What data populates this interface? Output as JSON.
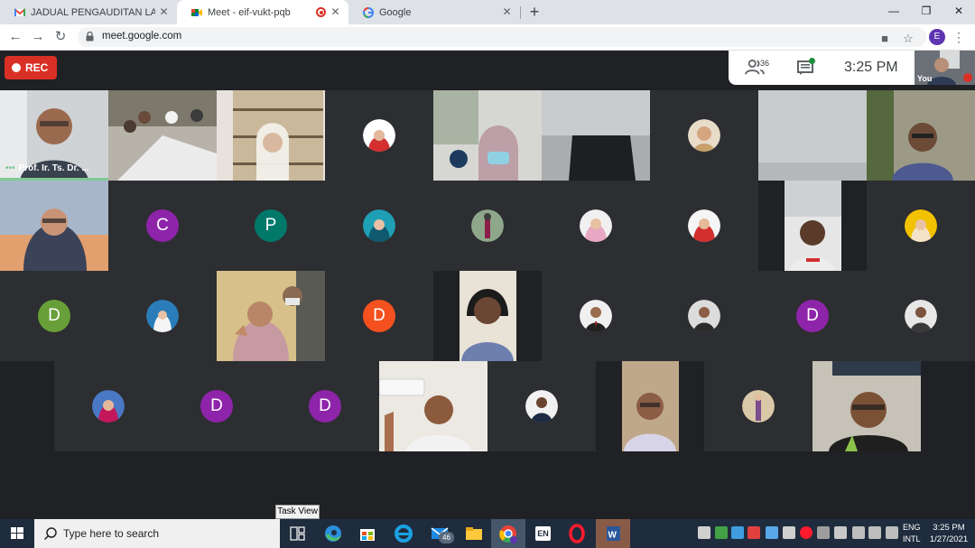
{
  "browser": {
    "tabs": [
      {
        "title": "JADUAL PENGAUDITAN LAWATA",
        "favicon": "gmail-icon",
        "active": false
      },
      {
        "title": "Meet - eif-vukt-pqb",
        "favicon": "meet-icon",
        "active": true,
        "recording": true
      },
      {
        "title": "Google",
        "favicon": "google-icon",
        "active": false
      }
    ],
    "new_tab_label": "+",
    "url": "meet.google.com",
    "profile_initial": "E"
  },
  "meet": {
    "rec_label": "REC",
    "participants_count": "36",
    "clock": "3:25 PM",
    "self_label": "You",
    "speaker_name": "Prof. Ir. Ts. Dr. ...",
    "letter_avatars": [
      {
        "letter": "C",
        "color": "#8e24aa"
      },
      {
        "letter": "P",
        "color": "#00796b"
      },
      {
        "letter": "D",
        "color": "#689f38"
      },
      {
        "letter": "D",
        "color": "#f4511e"
      },
      {
        "letter": "D",
        "color": "#8e24aa"
      },
      {
        "letter": "D",
        "color": "#8e24aa"
      },
      {
        "letter": "D",
        "color": "#8e24aa"
      }
    ]
  },
  "taskbar": {
    "search_placeholder": "Type here to search",
    "taskview_tooltip": "Task View",
    "mail_badge": "46",
    "lang_pill": "EN",
    "lang_line1": "ENG",
    "lang_line2": "INTL",
    "time": "3:25 PM",
    "date": "1/27/2021"
  }
}
